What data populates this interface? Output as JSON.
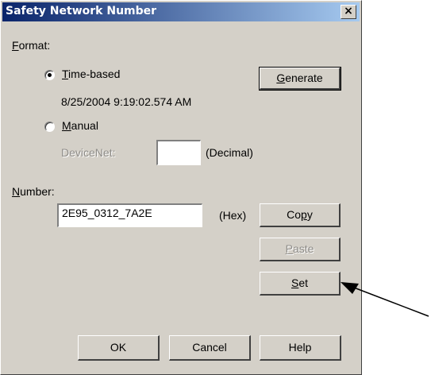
{
  "window": {
    "title": "Safety Network Number",
    "close_glyph": "×"
  },
  "format": {
    "label": "Format:",
    "time_based_label": "Time-based",
    "time_based_selected": true,
    "timestamp": "8/25/2004 9:19:02.574 AM",
    "manual_label": "Manual",
    "devicenet_label": "DeviceNet:",
    "devicenet_value": "",
    "decimal_label": "(Decimal)"
  },
  "number": {
    "label": "Number:",
    "value": "2E95_0312_7A2E",
    "hex_label": "(Hex)"
  },
  "buttons": {
    "generate": "Generate",
    "copy": "Copy",
    "paste": "Paste",
    "set": "Set",
    "ok": "OK",
    "cancel": "Cancel",
    "help": "Help"
  },
  "colors": {
    "dialog_bg": "#d4d0c8",
    "titlebar_start": "#0a246a",
    "titlebar_end": "#a6caf0",
    "disabled_text": "#8e8c88"
  }
}
